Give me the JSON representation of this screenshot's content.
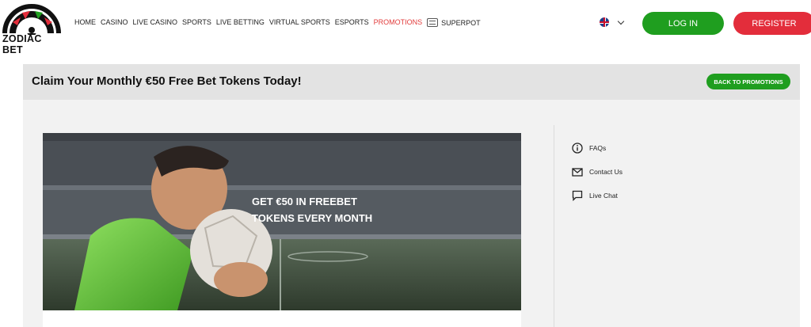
{
  "brand": {
    "name": "ZODIAC BET"
  },
  "nav": {
    "items": [
      {
        "label": "HOME"
      },
      {
        "label": "CASINO"
      },
      {
        "label": "LIVE CASINO"
      },
      {
        "label": "SPORTS"
      },
      {
        "label": "LIVE BETTING"
      },
      {
        "label": "VIRTUAL SPORTS"
      },
      {
        "label": "ESPORTS"
      },
      {
        "label": "PROMOTIONS"
      },
      {
        "label": "SUPERPOT"
      }
    ],
    "active": "PROMOTIONS"
  },
  "header": {
    "login_label": "LOG IN",
    "register_label": "REGISTER",
    "language_icon": "uk-flag-icon"
  },
  "titlebar": {
    "title": "Claim Your Monthly €50 Free Bet Tokens Today!",
    "back_label": "BACK TO PROMOTIONS"
  },
  "banner": {
    "line1": "GET €50 IN FREEBET",
    "line2": "TOKENS EVERY MONTH"
  },
  "sidebar": {
    "items": [
      {
        "label": "FAQs",
        "icon": "info-icon"
      },
      {
        "label": "Contact Us",
        "icon": "mail-icon"
      },
      {
        "label": "Live Chat",
        "icon": "chat-icon"
      }
    ]
  },
  "colors": {
    "green": "#1f9e1f",
    "red": "#e32d3b",
    "active_nav": "#e23b3b",
    "titlebar_bg": "#e3e3e3"
  }
}
